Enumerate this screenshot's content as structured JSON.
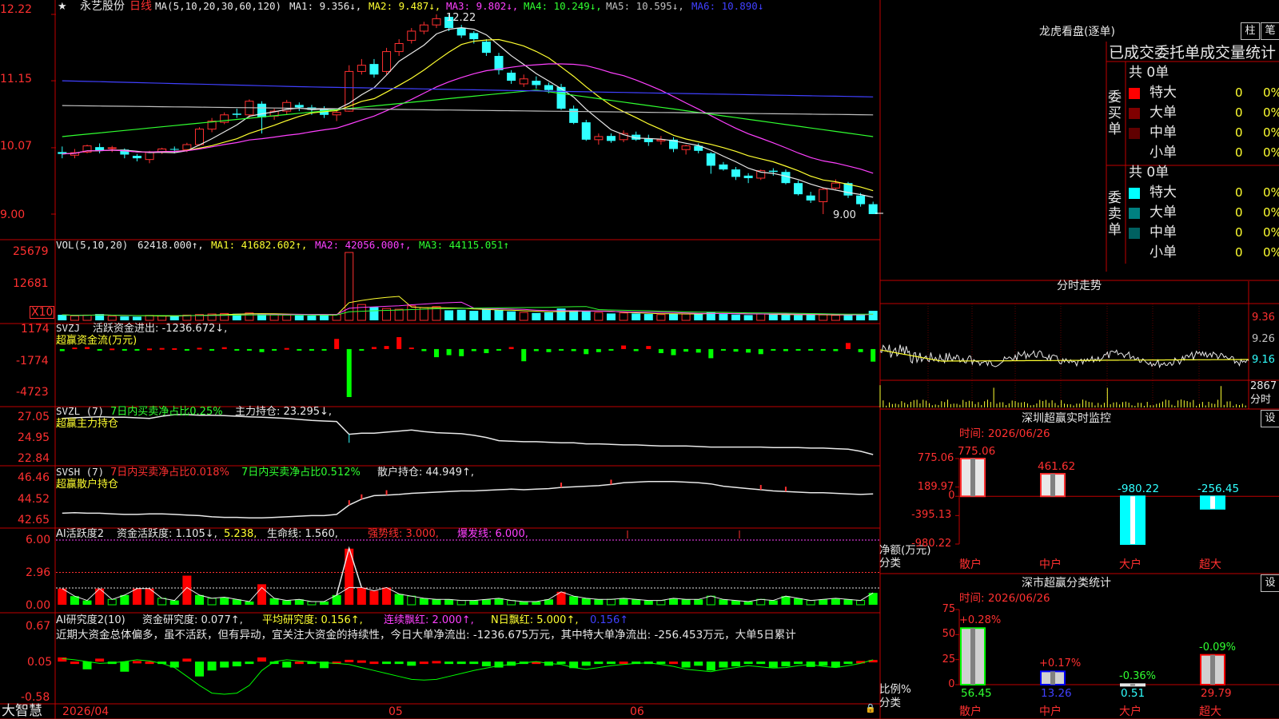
{
  "colors": {
    "grid": "#c00000",
    "up": "#ff3030",
    "down": "#30ffff",
    "ma1": "#e8e8e8",
    "ma2": "#ffff30",
    "ma3": "#ff40ff",
    "ma4": "#30ff30",
    "ma5": "#c0c0c0",
    "ma6": "#4040ff"
  },
  "header": {
    "star": "★",
    "stock_name": "永艺股份",
    "period": "日线",
    "ma_params": "MA(5,10,20,30,60,120)",
    "ma1": "MA1: 9.356↓,",
    "ma2": "MA2: 9.487↓,",
    "ma3": "MA3: 9.802↓,",
    "ma4": "MA4: 10.249↓,",
    "ma5": "MA5: 10.595↓,",
    "ma6": "MA6: 10.890↓"
  },
  "main_chart": {
    "y_labels": [
      "12.22",
      "11.15",
      "10.07",
      "9.00"
    ],
    "high_marker": "12.22",
    "low_marker": "9.00",
    "candles": [
      [
        10.0,
        9.97,
        10.09,
        9.9
      ],
      [
        9.95,
        9.99,
        10.05,
        9.9
      ],
      [
        10.0,
        10.1,
        10.12,
        9.98
      ],
      [
        10.08,
        10.03,
        10.14,
        9.98
      ],
      [
        10.06,
        10.07,
        10.1,
        10.0
      ],
      [
        10.04,
        9.96,
        10.06,
        9.9
      ],
      [
        9.94,
        9.9,
        9.97,
        9.85
      ],
      [
        9.88,
        10.0,
        10.02,
        9.82
      ],
      [
        10.0,
        10.05,
        10.07,
        9.97
      ],
      [
        10.05,
        10.04,
        10.09,
        9.98
      ],
      [
        10.04,
        10.12,
        10.15,
        10.0
      ],
      [
        10.12,
        10.37,
        10.4,
        10.1
      ],
      [
        10.37,
        10.5,
        10.55,
        10.32
      ],
      [
        10.48,
        10.6,
        10.64,
        10.45
      ],
      [
        10.62,
        10.6,
        10.7,
        10.55
      ],
      [
        10.6,
        10.82,
        10.85,
        10.55
      ],
      [
        10.78,
        10.56,
        10.82,
        10.3
      ],
      [
        10.58,
        10.66,
        10.7,
        10.52
      ],
      [
        10.66,
        10.8,
        10.84,
        10.6
      ],
      [
        10.76,
        10.72,
        10.8,
        10.66
      ],
      [
        10.72,
        10.68,
        10.76,
        10.6
      ],
      [
        10.7,
        10.6,
        10.74,
        10.55
      ],
      [
        10.6,
        10.64,
        10.68,
        10.5
      ],
      [
        10.66,
        11.3,
        11.4,
        10.65
      ],
      [
        11.3,
        11.4,
        11.5,
        11.25
      ],
      [
        11.42,
        11.25,
        11.5,
        11.2
      ],
      [
        11.3,
        11.62,
        11.68,
        11.25
      ],
      [
        11.62,
        11.75,
        11.82,
        11.55
      ],
      [
        11.8,
        11.95,
        12.0,
        11.75
      ],
      [
        11.95,
        12.05,
        12.1,
        11.9
      ],
      [
        12.05,
        12.15,
        12.22,
        12.0
      ],
      [
        12.18,
        12.0,
        12.22,
        11.95
      ],
      [
        12.0,
        11.88,
        12.05,
        11.84
      ],
      [
        11.92,
        11.82,
        11.95,
        11.75
      ],
      [
        11.78,
        11.6,
        11.82,
        11.55
      ],
      [
        11.55,
        11.32,
        11.6,
        11.25
      ],
      [
        11.28,
        11.15,
        11.32,
        11.1
      ],
      [
        11.1,
        11.18,
        11.25,
        11.05
      ],
      [
        11.15,
        11.08,
        11.22,
        11.02
      ],
      [
        11.08,
        11.0,
        11.12,
        10.95
      ],
      [
        11.05,
        10.7,
        11.1,
        10.68
      ],
      [
        10.7,
        10.47,
        10.75,
        10.45
      ],
      [
        10.48,
        10.2,
        10.52,
        10.18
      ],
      [
        10.2,
        10.25,
        10.3,
        10.12
      ],
      [
        10.26,
        10.18,
        10.3,
        10.15
      ],
      [
        10.2,
        10.3,
        10.35,
        10.16
      ],
      [
        10.28,
        10.2,
        10.33,
        10.18
      ],
      [
        10.22,
        10.16,
        10.28,
        10.1
      ],
      [
        10.18,
        10.2,
        10.26,
        10.12
      ],
      [
        10.2,
        10.05,
        10.24,
        10.0
      ],
      [
        10.04,
        10.1,
        10.12,
        9.96
      ],
      [
        10.1,
        10.02,
        10.14,
        9.98
      ],
      [
        9.98,
        9.78,
        10.0,
        9.65
      ],
      [
        9.8,
        9.72,
        9.84,
        9.7
      ],
      [
        9.72,
        9.6,
        9.76,
        9.55
      ],
      [
        9.62,
        9.58,
        9.66,
        9.5
      ],
      [
        9.58,
        9.7,
        9.72,
        9.55
      ],
      [
        9.7,
        9.68,
        9.74,
        9.62
      ],
      [
        9.68,
        9.5,
        9.72,
        9.48
      ],
      [
        9.5,
        9.32,
        9.54,
        9.3
      ],
      [
        9.3,
        9.22,
        9.36,
        9.18
      ],
      [
        9.2,
        9.4,
        9.42,
        9.0
      ],
      [
        9.42,
        9.5,
        9.56,
        9.4
      ],
      [
        9.5,
        9.3,
        9.52,
        9.26
      ],
      [
        9.3,
        9.16,
        9.34,
        9.12
      ],
      [
        9.16,
        9.0,
        9.2,
        9.0
      ]
    ]
  },
  "vol": {
    "title": "VOL(5,10,20)",
    "value": "62418.000↑,",
    "ma1": "MA1: 41682.602↑,",
    "ma2": "MA2: 42056.000↑,",
    "ma3": "MA3: 44115.051↑",
    "y_labels": [
      "25679",
      "12681"
    ],
    "unit": "X10",
    "values": [
      21000,
      17000,
      20000,
      24000,
      16000,
      15000,
      14000,
      19000,
      17000,
      16000,
      20000,
      22000,
      24000,
      26000,
      25000,
      28000,
      24000,
      22000,
      20000,
      19000,
      18000,
      20000,
      22000,
      256790,
      60000,
      50000,
      45000,
      42000,
      55000,
      48000,
      52000,
      38000,
      40000,
      36000,
      42000,
      40000,
      34000,
      30000,
      28000,
      30000,
      45000,
      38000,
      34000,
      30000,
      26000,
      28000,
      26000,
      24000,
      22000,
      25000,
      24000,
      26000,
      32000,
      24000,
      22000,
      20000,
      24000,
      23000,
      21000,
      20000,
      22000,
      21000,
      19000,
      20000,
      22000,
      36000
    ]
  },
  "svzj": {
    "title": "SVZJ",
    "label": "活跃资金进出: -1236.672↓,",
    "sub": "超赢资金流(万元)",
    "y_labels": [
      "1174",
      "-1774",
      "-4723"
    ],
    "values": [
      -200,
      150,
      200,
      -100,
      50,
      -150,
      -80,
      50,
      100,
      80,
      -50,
      120,
      -150,
      180,
      -100,
      -80,
      -300,
      -150,
      100,
      -50,
      -80,
      -50,
      1000,
      -4723,
      -50,
      200,
      300,
      1174,
      150,
      -200,
      -800,
      -600,
      -700,
      -200,
      -400,
      -150,
      200,
      -1200,
      -200,
      -300,
      -150,
      -200,
      -500,
      -300,
      -100,
      350,
      -200,
      300,
      -400,
      -600,
      -250,
      -350,
      -900,
      -100,
      -250,
      -350,
      -500,
      -150,
      -200,
      -150,
      -100,
      -150,
      -200,
      600,
      -300,
      -1237
    ]
  },
  "svzl": {
    "title": "SVZL (7)",
    "label_1": "7日内买卖净占比0.25%",
    "label_2": "主力持仓: 23.295↓,",
    "sub": "超赢主力持仓",
    "y_labels": [
      "27.05",
      "24.95",
      "22.84"
    ],
    "values": [
      26.7,
      26.75,
      26.8,
      26.85,
      26.8,
      26.8,
      26.75,
      26.7,
      26.9,
      27.05,
      27.05,
      27.0,
      27.0,
      26.95,
      26.9,
      26.85,
      26.8,
      26.75,
      26.7,
      26.6,
      26.5,
      26.45,
      26.4,
      25.2,
      25.3,
      25.3,
      25.4,
      25.5,
      25.6,
      25.45,
      25.35,
      25.3,
      25.25,
      25.1,
      24.9,
      24.6,
      24.55,
      24.5,
      24.5,
      24.45,
      24.4,
      24.4,
      24.3,
      24.3,
      24.25,
      24.2,
      24.2,
      24.15,
      24.1,
      24.1,
      24.1,
      24.05,
      24.0,
      24.0,
      24.0,
      24.0,
      24.0,
      23.95,
      23.95,
      23.95,
      23.9,
      23.9,
      23.85,
      23.8,
      23.6,
      23.29
    ]
  },
  "svsh": {
    "title": "SVSH (7)",
    "label_1": "7日内买卖净占比0.018%",
    "label_2": "7日内买卖净占比0.512%",
    "label_3": "散户持仓: 44.949↑,",
    "sub": "超赢散户持仓",
    "y_labels": [
      "46.46",
      "44.52",
      "42.65"
    ],
    "values": [
      43.3,
      43.35,
      43.3,
      43.3,
      43.25,
      43.2,
      43.2,
      43.25,
      43.25,
      43.2,
      43.15,
      43.1,
      43.0,
      42.95,
      42.95,
      42.9,
      42.9,
      42.95,
      43.0,
      43.05,
      43.1,
      43.1,
      43.2,
      44.0,
      44.5,
      44.8,
      44.85,
      44.9,
      45.0,
      45.05,
      45.1,
      45.15,
      45.2,
      45.2,
      45.25,
      45.3,
      45.35,
      45.3,
      45.35,
      45.4,
      45.5,
      45.55,
      45.6,
      45.65,
      45.75,
      45.9,
      45.95,
      46.0,
      46.0,
      46.0,
      45.95,
      45.9,
      45.8,
      45.6,
      45.5,
      45.4,
      45.3,
      45.2,
      45.15,
      45.1,
      45.05,
      45.05,
      45.0,
      44.95,
      44.9,
      44.95
    ]
  },
  "ai_activity": {
    "title": "AI活跃度2",
    "label_1": "资金活跃度: 1.105↓,",
    "label_2": "5.238,",
    "label_3": "生命线: 1.560,",
    "label_4": "强势线: 3.000,",
    "label_5": "爆发线: 6.000,",
    "y_labels": [
      "6.00",
      "2.96",
      "0.00"
    ],
    "values": [
      1.5,
      0.8,
      0.4,
      1.5,
      0.5,
      0.9,
      1.5,
      1.5,
      0.6,
      0.4,
      2.7,
      0.9,
      0.6,
      0.7,
      0.5,
      0.3,
      1.9,
      0.6,
      0.4,
      0.5,
      0.3,
      0.3,
      0.9,
      5.2,
      1.6,
      1.3,
      1.6,
      1.0,
      0.8,
      0.6,
      0.5,
      0.5,
      0.4,
      0.4,
      0.5,
      0.6,
      0.4,
      0.3,
      0.3,
      0.5,
      1.2,
      0.8,
      0.6,
      0.5,
      0.5,
      0.6,
      0.5,
      0.4,
      0.4,
      0.6,
      0.5,
      0.5,
      0.8,
      0.5,
      0.4,
      0.3,
      0.5,
      0.4,
      0.8,
      0.6,
      0.4,
      0.5,
      0.6,
      0.5,
      0.4,
      1.1
    ]
  },
  "ai_research": {
    "title": "AI研究度2(10)",
    "label_1": "资金研究度: 0.077↑,",
    "label_2": "平均研究度: 0.156↑,",
    "label_3": "连续飘红: 2.000↑,",
    "label_4": "N日飘红: 5.000↑,",
    "label_5": "0.156↑",
    "commentary": "近期大资金总体偏多，虽不活跃，但有异动，宜关注大资金的持续性，今日大单净流出: -1236.675万元，其中特大单净流出: -256.453万元，大单5日累计",
    "y_labels": [
      "0.67",
      "0.05",
      "-0.58"
    ],
    "values": [
      0.12,
      0.05,
      -0.08,
      0.1,
      0.02,
      -0.12,
      0.06,
      0.05,
      0.04,
      -0.05,
      0.1,
      -0.2,
      -0.1,
      -0.05,
      -0.03,
      0.02,
      0.12,
      0.03,
      -0.05,
      0.05,
      0.02,
      -0.06,
      0.05,
      0.08,
      0.07,
      0.05,
      0.02,
      0.04,
      -0.02,
      0.05,
      0.06,
      0.04,
      0.03,
      0.02,
      -0.03,
      -0.05,
      -0.02,
      0.03,
      0.05,
      -0.02,
      0.02,
      -0.06,
      -0.02,
      0.03,
      0.04,
      0.05,
      0.02,
      0.03,
      0.02,
      0.05,
      -0.05,
      -0.02,
      -0.1,
      -0.05,
      -0.03,
      0.03,
      0.02,
      -0.05,
      -0.03,
      0.02,
      -0.04,
      -0.02,
      -0.05,
      0.03,
      0.06,
      0.077
    ]
  },
  "date_axis": {
    "start": "2026/04",
    "m1": "05",
    "m2": "06"
  },
  "app_name": "大智慧",
  "right_panel": {
    "title": "龙虎看盘(逐单)",
    "btn_zhu": "柱",
    "btn_bi": "笔",
    "table_title": "已成交委托单成交量统计",
    "buy": {
      "group": "委买单",
      "count": "共 0单",
      "rows": [
        {
          "label": "特大",
          "vol": "0",
          "pct": "0%",
          "color": "#ff0000"
        },
        {
          "label": "大单",
          "vol": "0",
          "pct": "0%",
          "color": "#800000"
        },
        {
          "label": "中单",
          "vol": "0",
          "pct": "0%",
          "color": "#600000"
        },
        {
          "label": "小单",
          "vol": "0",
          "pct": "0%",
          "color": ""
        }
      ]
    },
    "sell": {
      "group": "委卖单",
      "count": "共 0单",
      "rows": [
        {
          "label": "特大",
          "vol": "0",
          "pct": "0%",
          "color": "#00ffff"
        },
        {
          "label": "大单",
          "vol": "0",
          "pct": "0%",
          "color": "#008080"
        },
        {
          "label": "中单",
          "vol": "0",
          "pct": "0%",
          "color": "#006060"
        },
        {
          "label": "小单",
          "vol": "0",
          "pct": "0%",
          "color": ""
        }
      ]
    },
    "intraday": {
      "title": "分时走势",
      "y_labels": [
        "9.36",
        "9.26",
        "9.16"
      ],
      "vol_label": "2867",
      "vol_unit": "分时"
    },
    "monitor": {
      "title": "深圳超赢实时监控",
      "setting": "设",
      "time": "时间: 2026/06/26",
      "y_labels": [
        "775.06",
        "189.97",
        "0",
        "-395.13",
        "-980.22"
      ],
      "axis_label_1": "净额(万元)",
      "axis_label_2": "分类",
      "bars": [
        {
          "cat": "散户",
          "value": 775.06,
          "label": "775.06"
        },
        {
          "cat": "中户",
          "value": 461.62,
          "label": "461.62"
        },
        {
          "cat": "大户",
          "value": -980.22,
          "label": "-980.22"
        },
        {
          "cat": "超大",
          "value": -256.45,
          "label": "-256.45"
        }
      ]
    },
    "classify": {
      "title": "深市超赢分类统计",
      "setting": "设",
      "time": "时间: 2026/06/26",
      "y_labels": [
        "75",
        "50",
        "25",
        "0"
      ],
      "axis_label_1": "比例%",
      "axis_label_2": "分类",
      "bars": [
        {
          "cat": "散户",
          "value": 56.45,
          "label": "56.45",
          "change": "+0.28%"
        },
        {
          "cat": "中户",
          "value": 13.26,
          "label": "13.26",
          "change": "+0.17%"
        },
        {
          "cat": "大户",
          "value": 0.51,
          "label": "0.51",
          "change": "-0.36%"
        },
        {
          "cat": "超大",
          "value": 29.79,
          "label": "29.79",
          "change": "-0.09%"
        }
      ]
    }
  }
}
